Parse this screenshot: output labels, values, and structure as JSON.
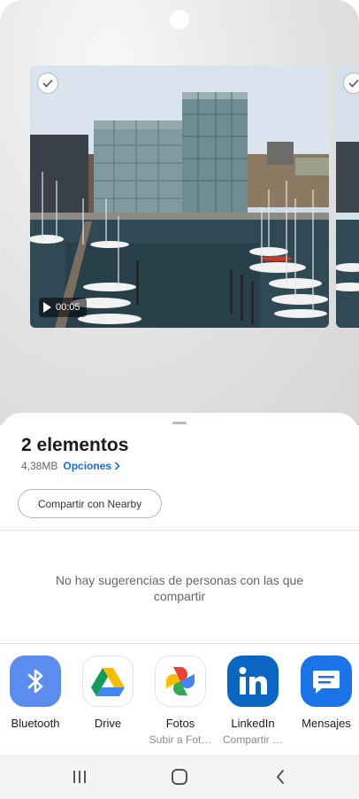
{
  "preview": {
    "duration": "00:05"
  },
  "sheet": {
    "title": "2 elementos",
    "size": "4,38MB",
    "options_label": "Opciones",
    "nearby_label": "Compartir con Nearby",
    "suggestion_text": "No hay sugerencias de personas con las que compartir"
  },
  "apps": [
    {
      "name": "Bluetooth",
      "subtitle": "",
      "icon": "bluetooth-icon",
      "color": "#5b8dee"
    },
    {
      "name": "Drive",
      "subtitle": "",
      "icon": "google-drive-icon",
      "color": "#ffffff"
    },
    {
      "name": "Fotos",
      "subtitle": "Subir a Fot…",
      "icon": "google-photos-icon",
      "color": "#ffffff"
    },
    {
      "name": "LinkedIn",
      "subtitle": "Compartir …",
      "icon": "linkedin-icon",
      "color": "#0a66c2"
    },
    {
      "name": "Mensajes",
      "subtitle": "",
      "icon": "messages-icon",
      "color": "#1a73e8"
    }
  ],
  "navigation": {
    "recent": "recent-apps-icon",
    "home": "home-icon",
    "back": "back-icon"
  }
}
